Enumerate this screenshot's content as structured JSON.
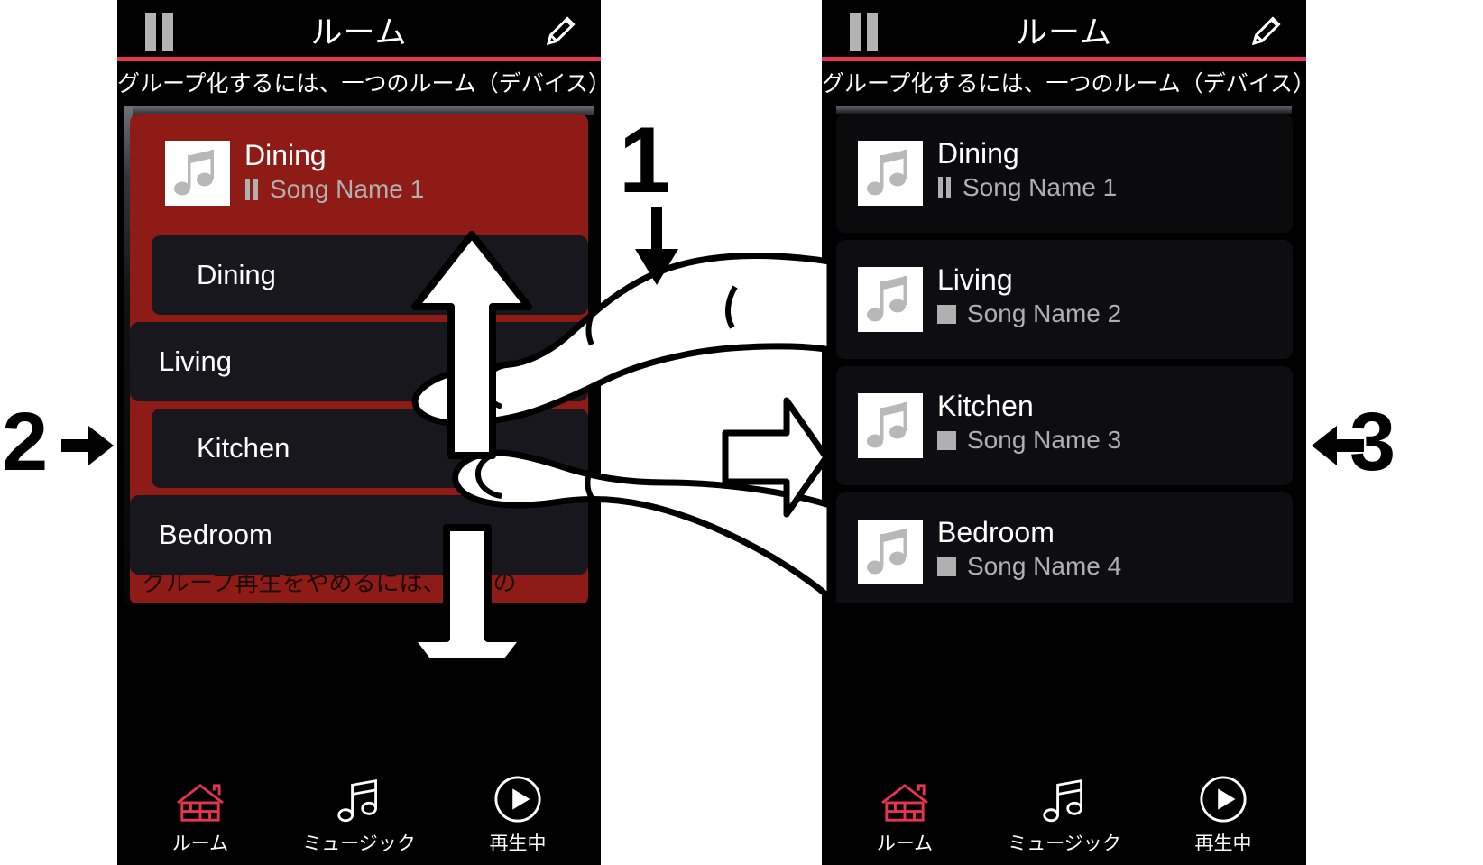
{
  "app": {
    "accent_red": "#e8344f",
    "group_red": "#8f1b16",
    "row_dark": "#19171e",
    "background": "#000000"
  },
  "left_phone": {
    "header": {
      "pause_icon": "pause-icon",
      "title": "ルーム",
      "edit_icon": "pencil-icon"
    },
    "subtitle": "グループ化するには、一つのルーム（デバイス）を別の",
    "now_playing": {
      "artwork_icon": "music-note-icon",
      "room": "Dining",
      "status_icon": "pause-icon",
      "song": "Song Name 1"
    },
    "rooms": [
      {
        "label": "Dining",
        "grouped": true
      },
      {
        "label": "Living",
        "grouped": false
      },
      {
        "label": "Kitchen",
        "grouped": true
      },
      {
        "label": "Bedroom",
        "grouped": false
      }
    ],
    "group_hint": "グループ再生をやめるには、対象の　　　　を",
    "nav": [
      {
        "label": "ルーム",
        "icon": "house-icon",
        "active": true
      },
      {
        "label": "ミュージック",
        "icon": "music-note-icon",
        "active": false
      },
      {
        "label": "再生中",
        "icon": "play-circle-icon",
        "active": false
      }
    ]
  },
  "right_phone": {
    "header": {
      "pause_icon": "pause-icon",
      "title": "ルーム",
      "edit_icon": "pencil-icon"
    },
    "subtitle": "グループ化するには、一つのルーム（デバイス）を別の",
    "rooms": [
      {
        "room": "Dining",
        "song": "Song Name 1",
        "status": "pause"
      },
      {
        "room": "Living",
        "song": "Song Name 2",
        "status": "stop"
      },
      {
        "room": "Kitchen",
        "song": "Song Name 3",
        "status": "stop"
      },
      {
        "room": "Bedroom",
        "song": "Song Name 4",
        "status": "stop"
      }
    ],
    "nav": [
      {
        "label": "ルーム",
        "icon": "house-icon",
        "active": true
      },
      {
        "label": "ミュージック",
        "icon": "music-note-icon",
        "active": false
      },
      {
        "label": "再生中",
        "icon": "play-circle-icon",
        "active": false
      }
    ]
  },
  "annotations": {
    "step1": "1",
    "step2": "2",
    "step3": "3",
    "step1_arrow": "arrow-down-icon",
    "step2_arrow": "arrow-right-icon",
    "step3_arrow": "arrow-left-icon",
    "gesture": "pinch-two-finger-icon",
    "gesture_up_arrow": "arrow-up-icon",
    "gesture_down_arrow": "arrow-down-icon",
    "transition_arrow": "arrow-right-icon"
  }
}
